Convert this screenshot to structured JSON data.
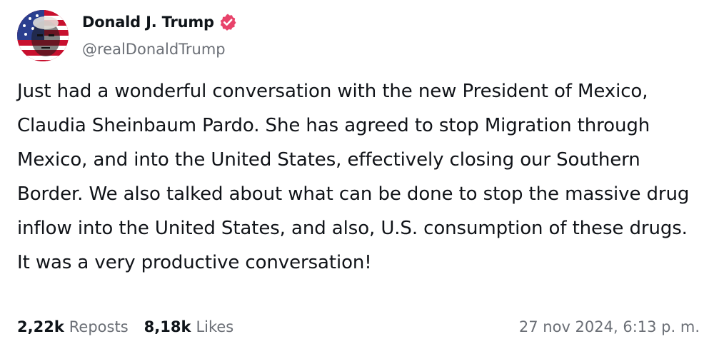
{
  "author": {
    "display_name": "Donald J. Trump",
    "handle": "@realDonaldTrump",
    "verified": true,
    "verified_color": "#e8436a",
    "avatar_icon": "profile-photo"
  },
  "post": {
    "text": "Just had a wonderful conversation with the new President of Mexico, Claudia Sheinbaum Pardo. She has agreed to stop Migration through Mexico, and into the United States, effectively closing our Southern Border. We also talked about what can be done to stop the massive drug inflow into the United States, and also, U.S. consumption of these drugs. It was a very productive conversation!"
  },
  "stats": {
    "reposts_count": "2,22k",
    "reposts_label": "Reposts",
    "likes_count": "8,18k",
    "likes_label": "Likes"
  },
  "timestamp": "27 nov 2024, 6:13 p. m."
}
